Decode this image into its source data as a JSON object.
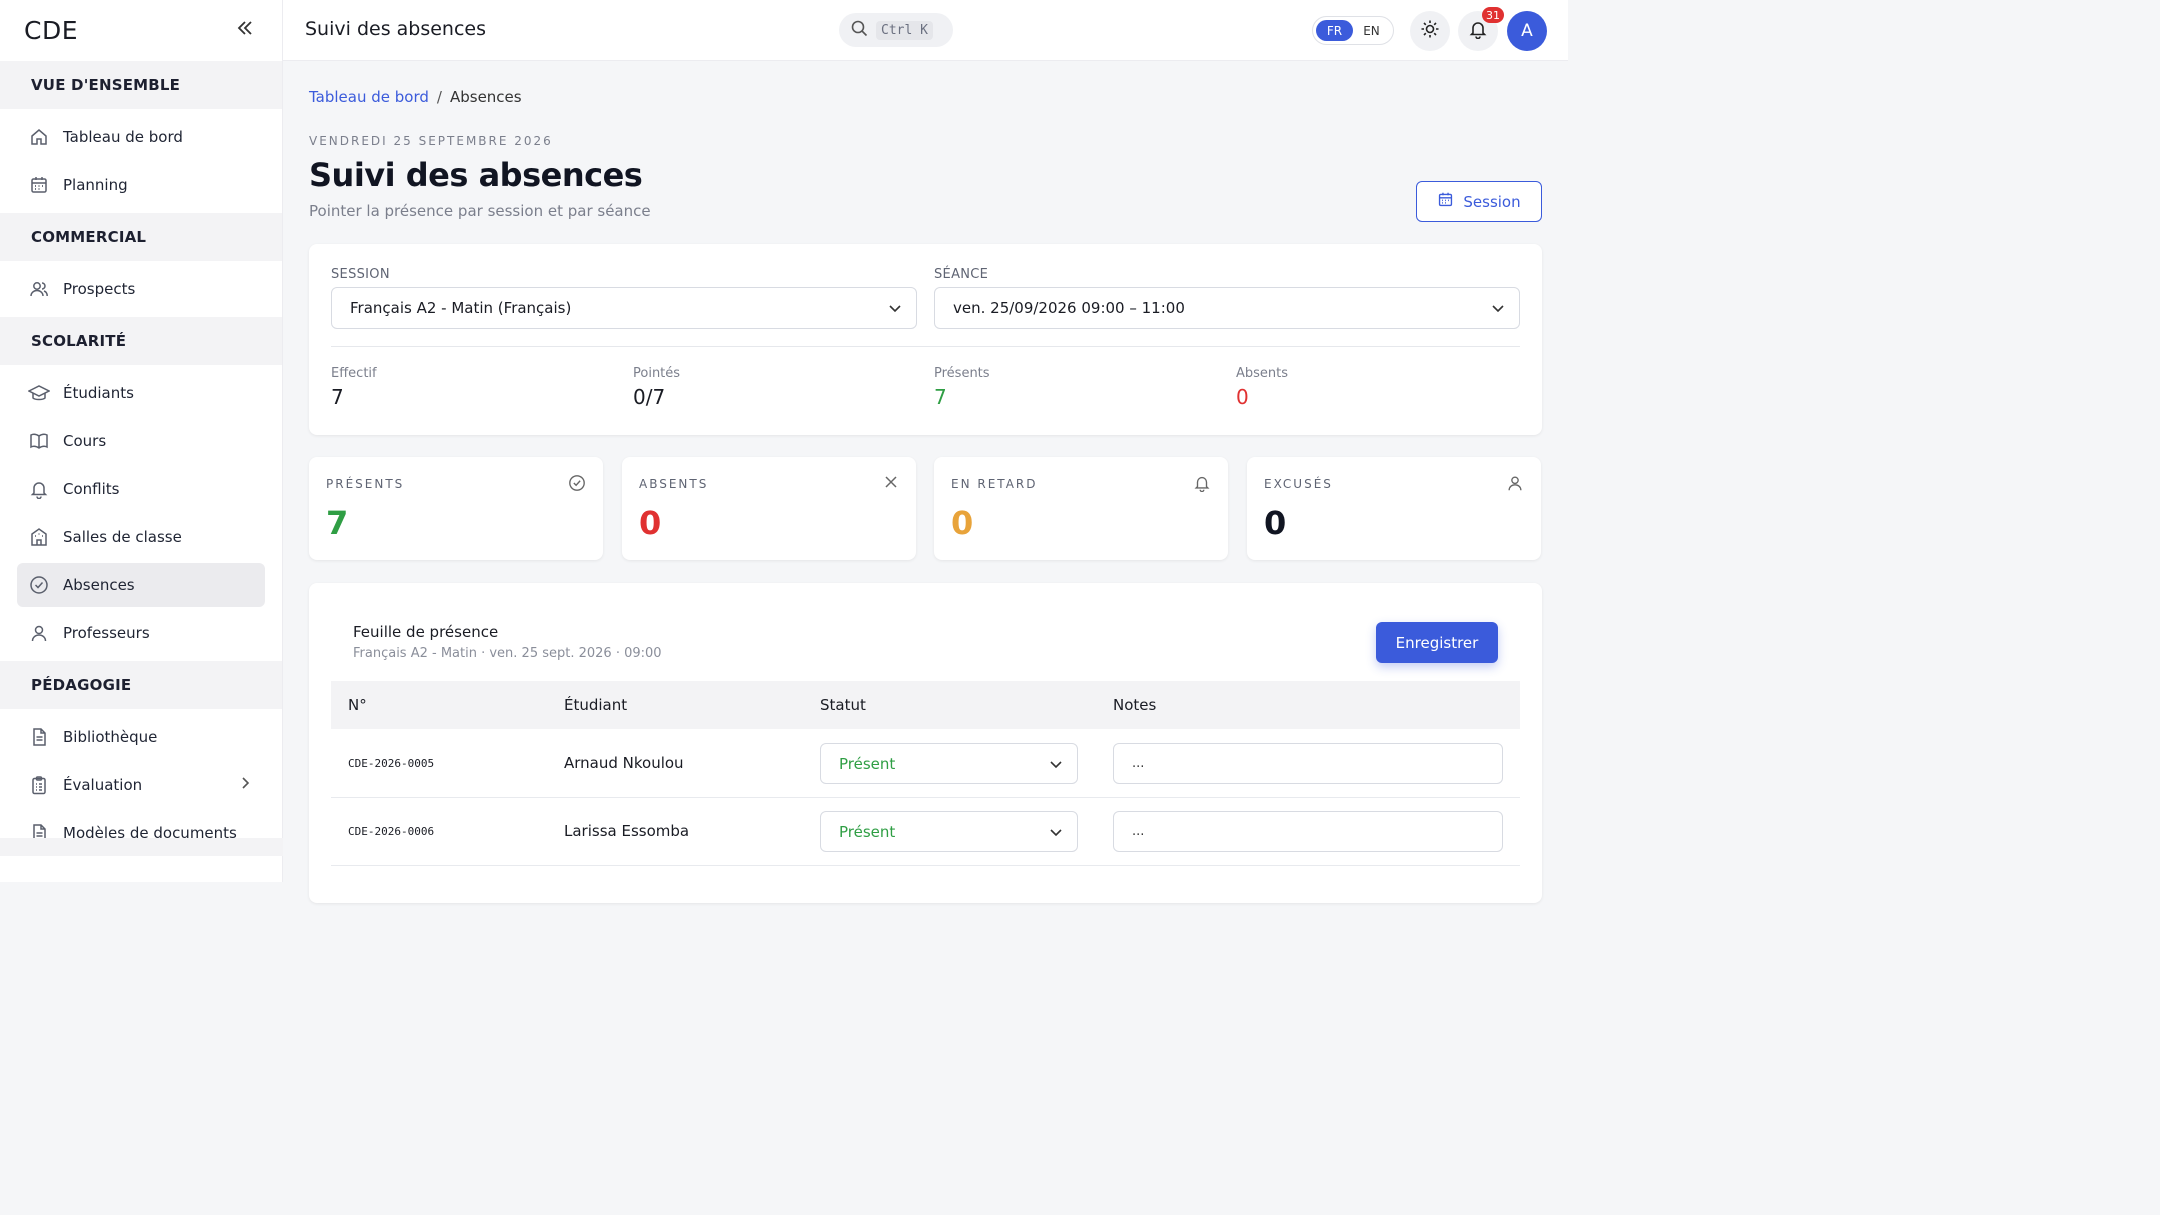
{
  "app": {
    "brand": "CDE",
    "page_title": "Suivi des absences"
  },
  "topbar": {
    "search_shortcut": "Ctrl K",
    "lang_fr": "FR",
    "lang_en": "EN",
    "notifications_count": "31",
    "avatar_initial": "A"
  },
  "sidebar": {
    "sections": [
      {
        "title": "VUE D'ENSEMBLE",
        "items": [
          {
            "label": "Tableau de bord",
            "icon": "home-icon"
          },
          {
            "label": "Planning",
            "icon": "calendar-icon"
          }
        ]
      },
      {
        "title": "COMMERCIAL",
        "items": [
          {
            "label": "Prospects",
            "icon": "users-icon"
          }
        ]
      },
      {
        "title": "SCOLARITÉ",
        "items": [
          {
            "label": "Étudiants",
            "icon": "graduation-cap-icon"
          },
          {
            "label": "Cours",
            "icon": "book-icon"
          },
          {
            "label": "Conflits",
            "icon": "bell-icon"
          },
          {
            "label": "Salles de classe",
            "icon": "building-icon"
          },
          {
            "label": "Absences",
            "icon": "check-circle-icon",
            "active": true
          },
          {
            "label": "Professeurs",
            "icon": "user-icon"
          }
        ]
      },
      {
        "title": "PÉDAGOGIE",
        "items": [
          {
            "label": "Bibliothèque",
            "icon": "document-icon"
          },
          {
            "label": "Évaluation",
            "icon": "clipboard-icon"
          },
          {
            "label": "Modèles de documents",
            "icon": "file-icon"
          }
        ]
      }
    ]
  },
  "breadcrumb": {
    "home": "Tableau de bord",
    "current": "Absences"
  },
  "header": {
    "date": "VENDREDI 25 SEPTEMBRE 2026",
    "title": "Suivi des absences",
    "subtitle": "Pointer la présence par session et par séance",
    "session_button": "Session"
  },
  "filters": {
    "session_label": "SESSION",
    "session_value": "Français A2 - Matin (Français)",
    "seance_label": "SÉANCE",
    "seance_value": "ven. 25/09/2026 09:00 – 11:00"
  },
  "stats": [
    {
      "label": "Effectif",
      "value": "7",
      "color": "#1a1c24"
    },
    {
      "label": "Pointés",
      "value": "0/7",
      "color": "#1a1c24"
    },
    {
      "label": "Présents",
      "value": "7",
      "color": "#2f9e44"
    },
    {
      "label": "Absents",
      "value": "0",
      "color": "#e03131"
    }
  ],
  "kpis": [
    {
      "label": "PRÉSENTS",
      "value": "7",
      "color": "#2f9e44",
      "icon": "check-circle-icon"
    },
    {
      "label": "ABSENTS",
      "value": "0",
      "color": "#e03131",
      "icon": "close-icon"
    },
    {
      "label": "EN RETARD",
      "value": "0",
      "color": "#e8a33a",
      "icon": "bell-icon"
    },
    {
      "label": "EXCUSÉS",
      "value": "0",
      "color": "#111522",
      "icon": "user-icon"
    }
  ],
  "sheet": {
    "title": "Feuille de présence",
    "subtitle": "Français A2 - Matin · ven. 25 sept. 2026 · 09:00",
    "save_button": "Enregistrer",
    "columns": [
      "N°",
      "Étudiant",
      "Statut",
      "Notes"
    ],
    "rows": [
      {
        "num": "CDE-2026-0005",
        "name": "Arnaud Nkoulou",
        "status": "Présent",
        "note": "..."
      },
      {
        "num": "CDE-2026-0006",
        "name": "Larissa Essomba",
        "status": "Présent",
        "note": "..."
      }
    ]
  }
}
